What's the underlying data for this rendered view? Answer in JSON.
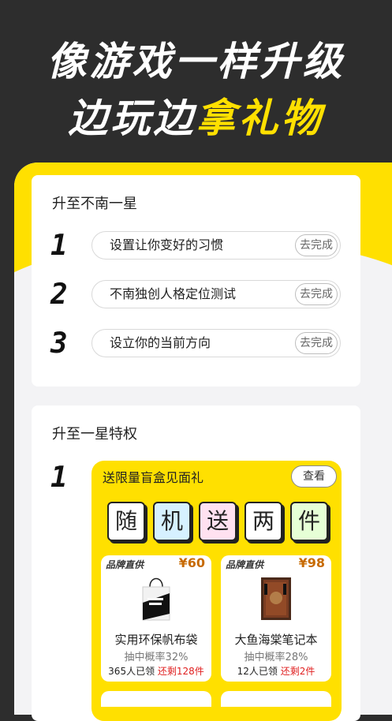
{
  "headline": {
    "line1": "像游戏一样升级",
    "line2_prefix": "边玩边",
    "line2_highlight": "拿礼物"
  },
  "colors": {
    "background": "#2d2d2d",
    "accent": "#ffe000",
    "price": "#c76a00",
    "stock_left": "#e02020"
  },
  "level_card": {
    "title": "升至不南一星",
    "tasks": [
      {
        "number": "1",
        "label": "设置让你变好的习惯",
        "button": "去完成"
      },
      {
        "number": "2",
        "label": "不南独创人格定位测试",
        "button": "去完成"
      },
      {
        "number": "3",
        "label": "设立你的当前方向",
        "button": "去完成"
      }
    ]
  },
  "privilege_card": {
    "title": "升至一星特权",
    "number": "1",
    "gift": {
      "title": "送限量盲盒见面礼",
      "view_button": "查看",
      "tiles": [
        "随",
        "机",
        "送",
        "两",
        "件"
      ],
      "products": [
        {
          "brand": "品牌直供",
          "price": "¥60",
          "name": "实用环保帆布袋",
          "rate": "抽中概率32%",
          "taken": "365人已领",
          "left": "还剩128件",
          "icon": "tote-bag-icon"
        },
        {
          "brand": "品牌直供",
          "price": "¥98",
          "name": "大鱼海棠笔记本",
          "rate": "抽中概率28%",
          "taken": "12人已领",
          "left": "还剩2件",
          "icon": "notebook-icon"
        }
      ]
    }
  }
}
